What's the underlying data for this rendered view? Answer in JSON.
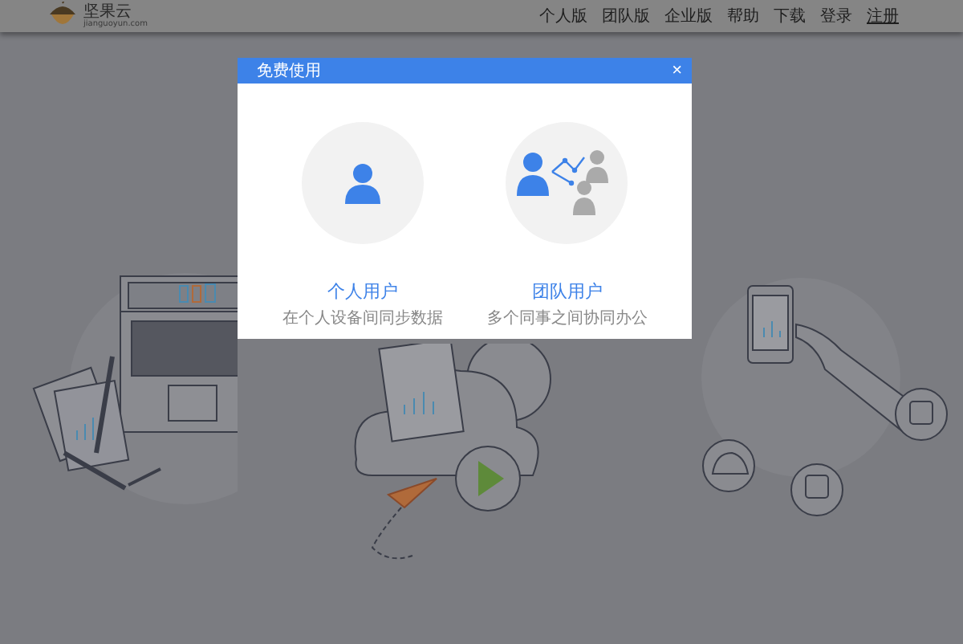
{
  "header": {
    "logo": {
      "name": "坚果云",
      "domain": "jianguoyun.com"
    },
    "nav": [
      {
        "label": "个人版",
        "underlined": false
      },
      {
        "label": "团队版",
        "underlined": false
      },
      {
        "label": "企业版",
        "underlined": false
      },
      {
        "label": "帮助",
        "underlined": false
      },
      {
        "label": "下载",
        "underlined": false
      },
      {
        "label": "登录",
        "underlined": false
      },
      {
        "label": "注册",
        "underlined": true
      }
    ]
  },
  "dialog": {
    "title": "免费使用",
    "close": "×",
    "options": [
      {
        "kind": "single",
        "title": "个人用户",
        "subtitle": "在个人设备间同步数据"
      },
      {
        "kind": "team",
        "title": "团队用户",
        "subtitle": "多个同事之间协同办公"
      }
    ]
  }
}
